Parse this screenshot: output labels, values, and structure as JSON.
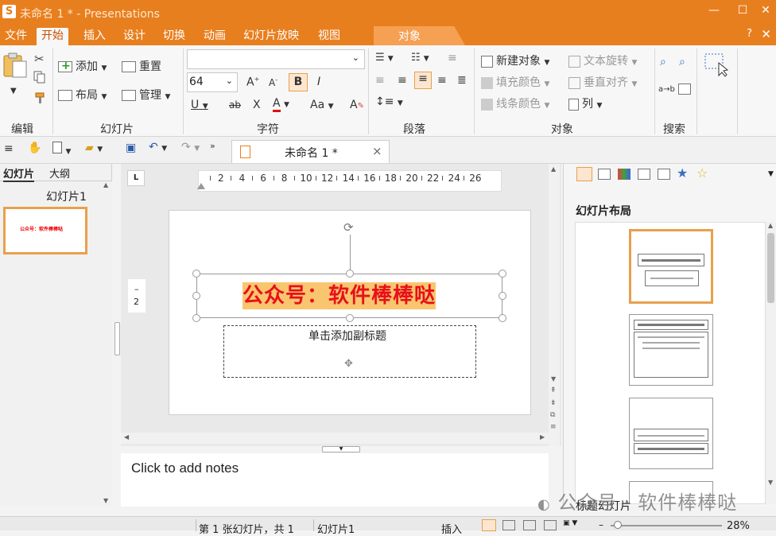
{
  "title": {
    "app_icon": "S",
    "text": "未命名 1 * - Presentations"
  },
  "window_controls": {
    "minimize": "—",
    "maximize": "☐",
    "close": "✕"
  },
  "menu": {
    "items": [
      "文件",
      "开始",
      "插入",
      "设计",
      "切换",
      "动画",
      "幻灯片放映",
      "视图"
    ],
    "active": "开始",
    "context_tab": "对象",
    "help": "?",
    "close": "✕"
  },
  "ribbon": {
    "edit_group": {
      "label": "编辑"
    },
    "slide_group": {
      "label": "幻灯片",
      "add": "添加",
      "reset": "重置",
      "layout": "布局",
      "manage": "管理"
    },
    "char_group": {
      "label": "字符",
      "font_name": "",
      "font_size": "64",
      "grow": "A",
      "shrink": "A",
      "bold": "B",
      "italic": "I",
      "underline": "U",
      "strike": "ab",
      "xscript": "X",
      "font_color": "A",
      "case": "Aa",
      "highlight": "A"
    },
    "para_group": {
      "label": "段落"
    },
    "object_group": {
      "label": "对象",
      "new_object": "新建对象",
      "fill_color": "填充颜色",
      "line_color": "线条颜色",
      "text_rotate": "文本旋转",
      "valign": "垂直对齐",
      "columns": "列"
    },
    "search_group": {
      "label": "搜索",
      "replace": "a→b"
    }
  },
  "document": {
    "tab_title": "未命名 1 *",
    "tab_close": "×"
  },
  "left_panel": {
    "tab_slides": "幻灯片",
    "tab_outline": "大纲",
    "slide_name": "幻灯片1",
    "thumb_text": "公众号：软件棒棒哒"
  },
  "ruler": {
    "numbers": [
      "2",
      "4",
      "6",
      "8",
      "10",
      "12",
      "14",
      "16",
      "18",
      "20",
      "22",
      "24",
      "26"
    ],
    "corner": "L",
    "v_marker": "2"
  },
  "slide": {
    "title": "公众号：软件棒棒哒",
    "subtitle_placeholder": "单击添加副标题"
  },
  "notes": {
    "placeholder": "Click to add notes"
  },
  "right_panel": {
    "title": "幻灯片布局",
    "selected_layout_name": "标题幻灯片"
  },
  "watermark": {
    "text": "公众号 · 软件棒棒哒"
  },
  "status": {
    "slide_count": "第 1 张幻灯片，共 1",
    "slide_name": "幻灯片1",
    "mode": "插入",
    "zoom": "28%"
  },
  "colors": {
    "accent": "#e87f1f",
    "title_red": "#e8101a",
    "title_highlight": "#f9c56e",
    "selection": "#e8a04c"
  }
}
